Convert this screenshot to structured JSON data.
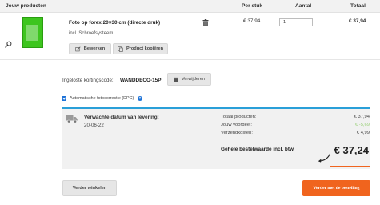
{
  "table_header": {
    "products": "Jouw producten",
    "unit_price": "Per stuk",
    "quantity": "Aantal",
    "total": "Totaal"
  },
  "product": {
    "title": "Foto op forex 20×30 cm (directe druk)",
    "subtitle": "incl. Schroefsysteem",
    "edit_label": "Bewerken",
    "copy_label": "Product kopiëren",
    "unit_price": "€ 37,94",
    "quantity": "1",
    "total": "€ 37,94",
    "thumbnail_color": "#3dc51e"
  },
  "coupon": {
    "label": "Ingeloste kortingscode:",
    "code": "WANDDECO-15P",
    "remove_label": "Verwijderen"
  },
  "auto_correction": {
    "label": "Automatische fotocorrectie (DPC)",
    "checked": true
  },
  "delivery": {
    "title": "Verwachte datum van levering:",
    "date": "20-06-22"
  },
  "summary": {
    "total_products_label": "Totaal producten:",
    "total_products_value": "€ 37,94",
    "discount_label": "Jouw voordeel:",
    "discount_value": "€ -5,69",
    "shipping_label": "Verzendkosten:",
    "shipping_value": "€ 4,99",
    "grand_total_label": "Gehele bestelwaarde incl. btw",
    "grand_total_value": "€ 37,24"
  },
  "actions": {
    "continue_label": "Verder winkelen",
    "order_label": "Verder met de bestelling"
  },
  "colors": {
    "accent_orange": "#f0641e",
    "accent_blue": "#2a9fd8",
    "discount_green": "#9ad07a"
  }
}
